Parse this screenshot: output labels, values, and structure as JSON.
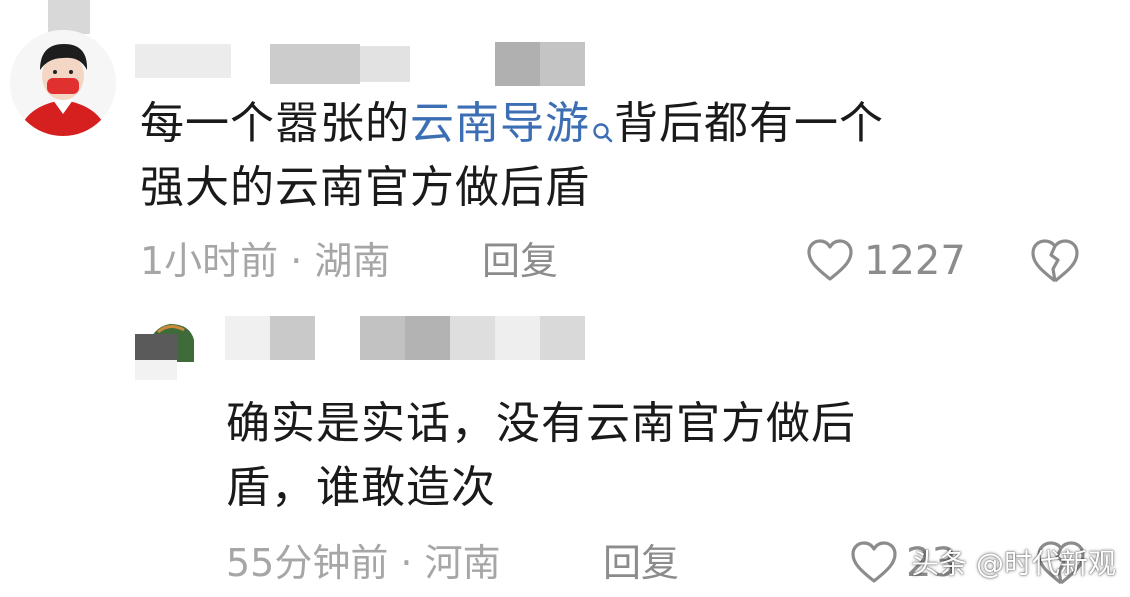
{
  "comment1": {
    "line1_before": "每一个嚣张的",
    "link_text": "云南导游",
    "line1_after": "背后都有一个",
    "line2": "强大的云南官方做后盾",
    "time_location": "1小时前 · 湖南",
    "reply_label": "回复",
    "like_count": "1227",
    "icons": {
      "like": "heart-outline-icon",
      "dislike": "broken-heart-icon",
      "search": "search-icon"
    }
  },
  "comment2": {
    "line1": "确实是实话，没有云南官方做后",
    "line2": "盾，谁敢造次",
    "time_location": "55分钟前 · 河南",
    "reply_label": "回复",
    "like_count": "23"
  },
  "watermark": "头条 @时代新观",
  "colors": {
    "link": "#3c6eb4",
    "text": "#1a1a1a",
    "meta": "#a6a6a6",
    "avatar_shirt": "#d62020"
  }
}
